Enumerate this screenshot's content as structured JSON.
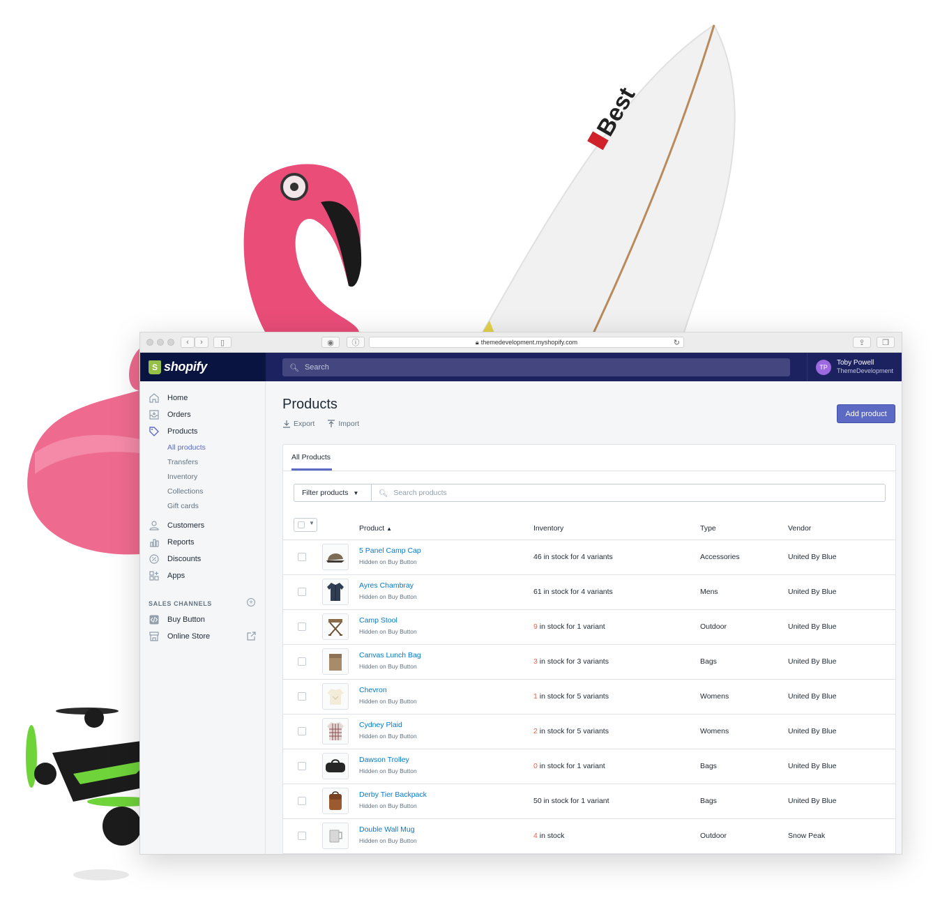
{
  "browser": {
    "url": "themedevelopment.myshopify.com"
  },
  "brand": {
    "name": "shopify",
    "bag_letter": "S"
  },
  "search": {
    "placeholder": "Search"
  },
  "user": {
    "initials": "TP",
    "name": "Toby Powell",
    "store": "ThemeDevelopment"
  },
  "sidebar": {
    "home": "Home",
    "orders": "Orders",
    "products": "Products",
    "sub": [
      "All products",
      "Transfers",
      "Inventory",
      "Collections",
      "Gift cards"
    ],
    "customers": "Customers",
    "reports": "Reports",
    "discounts": "Discounts",
    "apps": "Apps",
    "sales_channels": "SALES CHANNELS",
    "buy_button": "Buy Button",
    "online_store": "Online Store"
  },
  "page": {
    "title": "Products",
    "export": "Export",
    "import": "Import",
    "add_product": "Add product",
    "tab": "All Products",
    "filter": "Filter products",
    "search_placeholder": "Search products"
  },
  "table": {
    "headers": {
      "product": "Product",
      "inventory": "Inventory",
      "type": "Type",
      "vendor": "Vendor"
    },
    "rows": [
      {
        "name": "5 Panel Camp Cap",
        "sub": "Hidden on Buy Button",
        "inv_num": "",
        "inv_rest": "46 in stock for 4 variants",
        "type": "Accessories",
        "vendor": "United By Blue"
      },
      {
        "name": "Ayres Chambray",
        "sub": "Hidden on Buy Button",
        "inv_num": "",
        "inv_rest": "61 in stock for 4 variants",
        "type": "Mens",
        "vendor": "United By Blue"
      },
      {
        "name": "Camp Stool",
        "sub": "Hidden on Buy Button",
        "inv_num": "9",
        "inv_rest": " in stock for 1 variant",
        "type": "Outdoor",
        "vendor": "United By Blue"
      },
      {
        "name": "Canvas Lunch Bag",
        "sub": "Hidden on Buy Button",
        "inv_num": "3",
        "inv_rest": " in stock for 3 variants",
        "type": "Bags",
        "vendor": "United By Blue"
      },
      {
        "name": "Chevron",
        "sub": "Hidden on Buy Button",
        "inv_num": "1",
        "inv_rest": " in stock for 5 variants",
        "type": "Womens",
        "vendor": "United By Blue"
      },
      {
        "name": "Cydney Plaid",
        "sub": "Hidden on Buy Button",
        "inv_num": "2",
        "inv_rest": " in stock for 5 variants",
        "type": "Womens",
        "vendor": "United By Blue"
      },
      {
        "name": "Dawson Trolley",
        "sub": "Hidden on Buy Button",
        "inv_num": "0",
        "inv_rest": " in stock for 1 variant",
        "type": "Bags",
        "vendor": "United By Blue"
      },
      {
        "name": "Derby Tier Backpack",
        "sub": "Hidden on Buy Button",
        "inv_num": "",
        "inv_rest": "50 in stock for 1 variant",
        "type": "Bags",
        "vendor": "United By Blue"
      },
      {
        "name": "Double Wall Mug",
        "sub": "Hidden on Buy Button",
        "inv_num": "4",
        "inv_rest": " in stock",
        "type": "Outdoor",
        "vendor": "Snow Peak"
      }
    ]
  },
  "surfboard_logo": "Best",
  "colors": {
    "accent": "#5c6ac4",
    "topbar": "#1c2260",
    "link": "#007ace",
    "low_stock": "#ed6347",
    "brand_green": "#95bf47"
  }
}
